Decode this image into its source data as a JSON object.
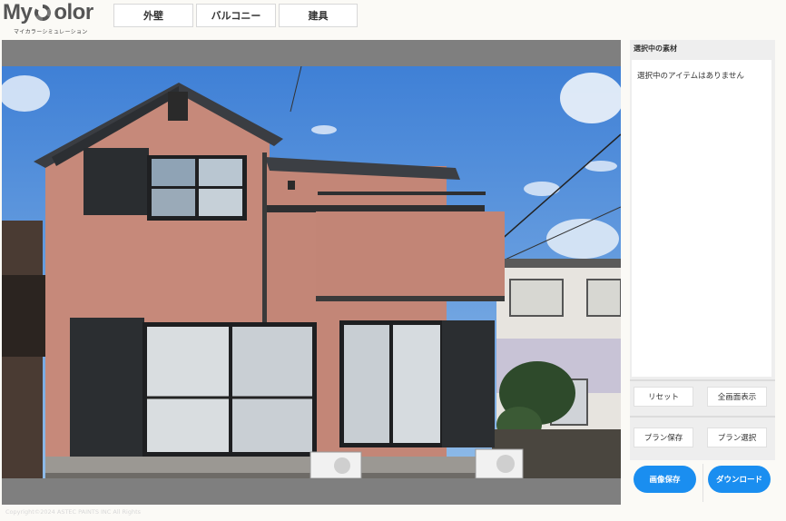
{
  "logo": {
    "word_left": "My ",
    "word_right": "olor",
    "subtitle": "マイカラーシミュレーション"
  },
  "tabs": [
    {
      "label": "外壁"
    },
    {
      "label": "バルコニー"
    },
    {
      "label": "建具"
    }
  ],
  "panel": {
    "title": "選択中の素材",
    "empty_message": "選択中のアイテムはありません",
    "reset_label": "リセット",
    "fullscreen_label": "全画面表示",
    "save_plan_label": "プラン保存",
    "select_plan_label": "プラン選択",
    "save_image_label": "画像保存",
    "download_label": "ダウンロード"
  },
  "footer": {
    "copyright": "Copyright©2024 ASTEC PAINTS INC All Rights"
  },
  "colors": {
    "accent_blue": "#1a8ef0",
    "wall_color": "#c6897a",
    "frame_gray": "#7f7f7f"
  },
  "icons": {
    "logo_ring": "color-ring-icon"
  }
}
